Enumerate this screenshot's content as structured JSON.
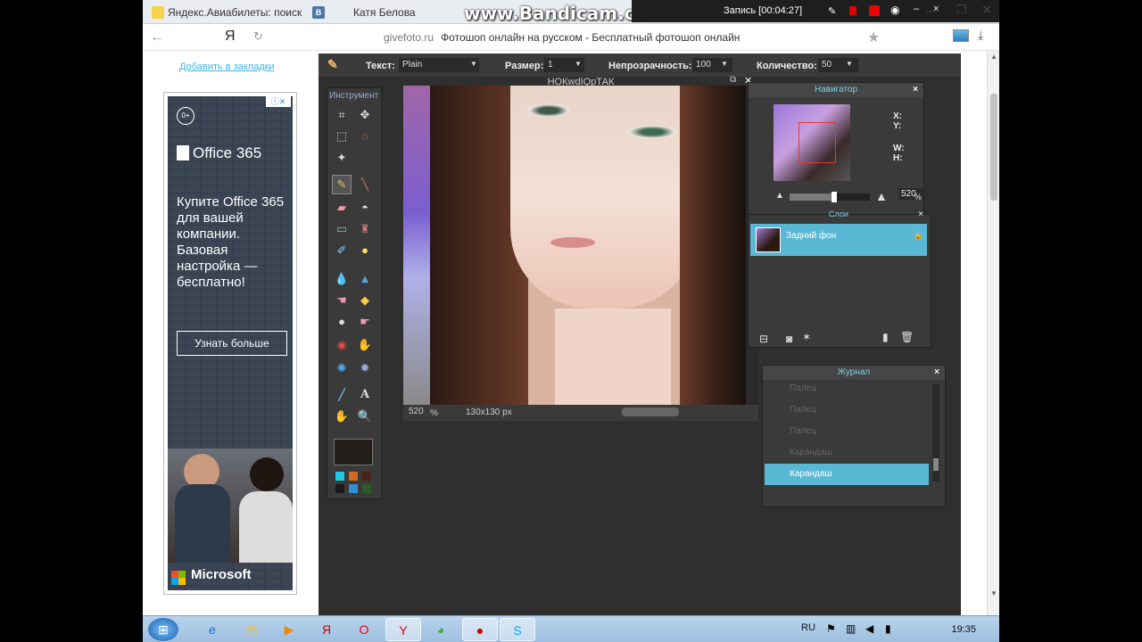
{
  "tabs": [
    {
      "label": "Яндекс.Авиабилеты: поиск и",
      "color": "#ffcc00"
    },
    {
      "label": "Катя Белова",
      "color": "#4a76a8"
    }
  ],
  "overlay": {
    "watermark": "www.Bandicam.com",
    "record_label": "Запись [00:04:27]"
  },
  "browser": {
    "back_icon": "back-arrow-icon",
    "yandex_logo": "Я",
    "domain": "givefoto.ru",
    "title": "Фотошоп онлайн на русском - Бесплатный фотошоп онлайн"
  },
  "page": {
    "bookmark_link": "Добавить в закладки",
    "ad": {
      "age": "0+",
      "brand": "Office 365",
      "text": "Купите Office 365 для вашей компании. Базовая настройка — бесплатно!",
      "button": "Узнать больше",
      "vendor": "Microsoft"
    }
  },
  "editor": {
    "toolbar": {
      "text_label": "Текст:",
      "text_value": "Plain",
      "size_label": "Размер:",
      "size_value": "1",
      "opacity_label": "Непрозрачность:",
      "opacity_value": "100",
      "count_label": "Количество:",
      "count_value": "50"
    },
    "tools_title": "Инструмент",
    "canvas": {
      "title": "НОКwdIQрТАК",
      "zoom": "520",
      "zoom_unit": "%",
      "size": "130x130 px"
    },
    "navigator": {
      "title": "Навигатор",
      "x_label": "X:",
      "y_label": "Y:",
      "w_label": "W:",
      "h_label": "H:",
      "zoom": "520",
      "zoom_unit": "%",
      "zoom_level": 0.55
    },
    "layers": {
      "title": "Слои",
      "items": [
        {
          "name": "Задний фон"
        }
      ]
    },
    "history": {
      "title": "Журнал",
      "items": [
        {
          "label": "Палец"
        },
        {
          "label": "Палец"
        },
        {
          "label": "Палец"
        },
        {
          "label": "Карандаш"
        },
        {
          "label": "Карандаш"
        }
      ]
    }
  },
  "taskbar": {
    "language": "RU",
    "time": "19:35"
  }
}
